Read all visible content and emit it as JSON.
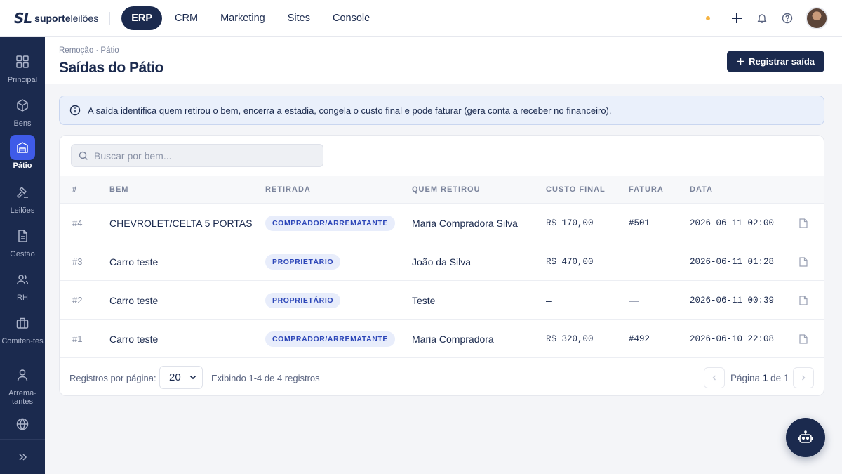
{
  "brand": {
    "mark": "SL",
    "name_bold": "suporte",
    "name_rest": "leilões"
  },
  "topnav": [
    {
      "label": "ERP"
    },
    {
      "label": "CRM"
    },
    {
      "label": "Marketing"
    },
    {
      "label": "Sites"
    },
    {
      "label": "Console"
    }
  ],
  "sidebar": {
    "items": [
      {
        "label": "Principal",
        "icon": "grid-icon"
      },
      {
        "label": "Bens",
        "icon": "box-icon"
      },
      {
        "label": "Pátio",
        "icon": "warehouse-icon"
      },
      {
        "label": "Leilões",
        "icon": "gavel-icon"
      },
      {
        "label": "Gestão",
        "icon": "document-icon"
      },
      {
        "label": "RH",
        "icon": "users-icon"
      },
      {
        "label": "Comiten-tes",
        "icon": "briefcase-icon"
      },
      {
        "label": "Arrema-tantes",
        "icon": "user-icon"
      },
      {
        "label": "",
        "icon": "globe-icon"
      }
    ]
  },
  "page": {
    "breadcrumb": "Remoção · Pátio",
    "title": "Saídas do Pátio",
    "primary_button": "Registrar saída"
  },
  "info": {
    "text": "A saída identifica quem retirou o bem, encerra a estadia, congela o custo final e pode faturar (gera conta a receber no financeiro)."
  },
  "search": {
    "placeholder": "Buscar por bem..."
  },
  "table": {
    "columns": [
      "#",
      "BEM",
      "RETIRADA",
      "QUEM RETIROU",
      "CUSTO FINAL",
      "FATURA",
      "DATA"
    ],
    "rows": [
      {
        "num": "#4",
        "bem": "CHEVROLET/CELTA 5 PORTAS",
        "retirada": "COMPRADOR/ARREMATANTE",
        "quem": "Maria Compradora Silva",
        "custo": "R$ 170,00",
        "fatura": "#501",
        "data": "2026-06-11 02:00"
      },
      {
        "num": "#3",
        "bem": "Carro teste",
        "retirada": "PROPRIETÁRIO",
        "quem": "João da Silva",
        "custo": "R$ 470,00",
        "fatura": "—",
        "data": "2026-06-11 01:28"
      },
      {
        "num": "#2",
        "bem": "Carro teste",
        "retirada": "PROPRIETÁRIO",
        "quem": "Teste",
        "custo": "–",
        "fatura": "—",
        "data": "2026-06-11 00:39"
      },
      {
        "num": "#1",
        "bem": "Carro teste",
        "retirada": "COMPRADOR/ARREMATANTE",
        "quem": "Maria Compradora",
        "custo": "R$ 320,00",
        "fatura": "#492",
        "data": "2026-06-10 22:08"
      }
    ]
  },
  "footer": {
    "per_page_label": "Registros por página:",
    "per_page_value": "20",
    "showing": "Exibindo 1-4 de 4 registros",
    "page_prefix": "Página",
    "page_current": "1",
    "page_of": "de",
    "page_total": "1"
  },
  "colors": {
    "navy": "#1b2a4e",
    "accent": "#3f5be8",
    "status_dot": "#f5b342",
    "badge_text": "#2c46b8"
  }
}
